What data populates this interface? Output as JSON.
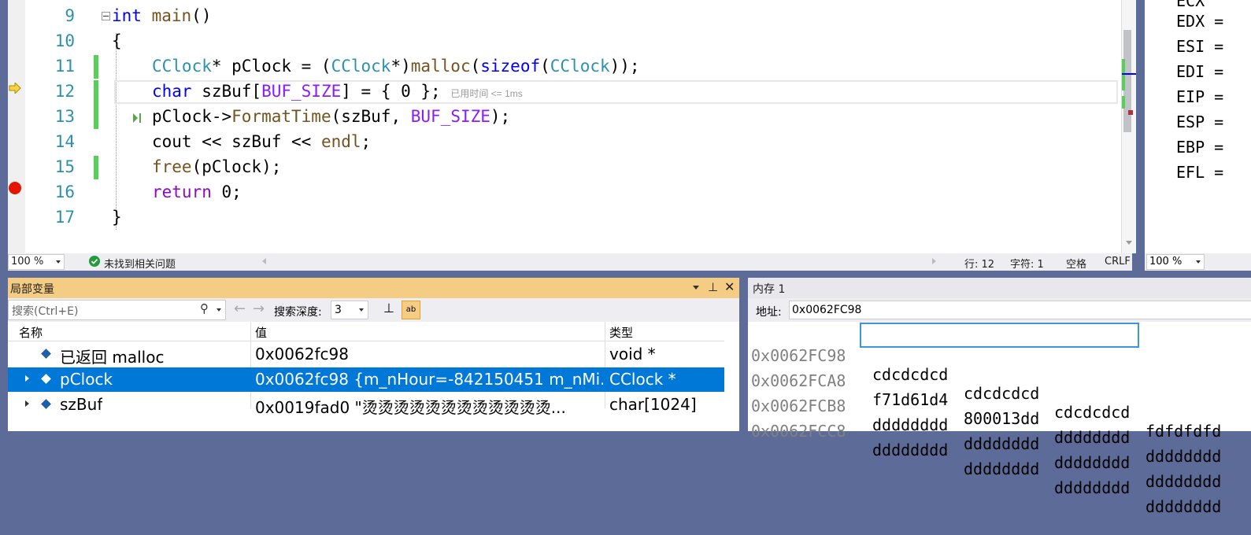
{
  "editor": {
    "lines": [
      {
        "num": "9"
      },
      {
        "num": "10"
      },
      {
        "num": "11"
      },
      {
        "num": "12"
      },
      {
        "num": "13"
      },
      {
        "num": "14"
      },
      {
        "num": "15"
      },
      {
        "num": "16"
      },
      {
        "num": "17"
      }
    ],
    "code": {
      "l9_kw": "int",
      "l9_fn": "main",
      "l9_rest": "()",
      "l10": "{",
      "l11_ty": "CClock",
      "l11_a": "* pClock = (",
      "l11_ty2": "CClock",
      "l11_b": "*)",
      "l11_fn": "malloc",
      "l11_c": "(",
      "l11_kw": "sizeof",
      "l11_d": "(",
      "l11_ty3": "CClock",
      "l11_e": "));",
      "l12_kw": "char",
      "l12_a": " szBuf[",
      "l12_mac": "BUF_SIZE",
      "l12_b": "] = { 0 };",
      "l12_hint": "已用时间 <= 1ms",
      "l13_a": "pClock->",
      "l13_fn": "FormatTime",
      "l13_b": "(szBuf, ",
      "l13_mac": "BUF_SIZE",
      "l13_c": ");",
      "l14_a": "cout << szBuf << ",
      "l14_fn": "endl",
      "l14_b": ";",
      "l15_fn": "free",
      "l15_a": "(pClock);",
      "l16_kw": "return",
      "l16_a": " 0;",
      "l17": "}"
    },
    "zoom": "100 %",
    "issues": "未找到相关问题",
    "row_label": "行: 12",
    "col_label": "字符: 1",
    "whitespace": "空格",
    "eol": "CRLF"
  },
  "registers": {
    "items": [
      {
        "name": "EDX ="
      },
      {
        "name": "ESI ="
      },
      {
        "name": "EDI ="
      },
      {
        "name": "EIP ="
      },
      {
        "name": "ESP ="
      },
      {
        "name": "EBP ="
      },
      {
        "name": "EFL ="
      }
    ],
    "zoom": "100 %"
  },
  "locals": {
    "title": "局部变量",
    "search_placeholder": "搜索(Ctrl+E)",
    "depth_label": "搜索深度:",
    "depth_value": "3",
    "columns": {
      "name": "名称",
      "value": "值",
      "type": "类型"
    },
    "rows": [
      {
        "name": "已返回 malloc",
        "value": "0x0062fc98",
        "type": "void *"
      },
      {
        "name": "pClock",
        "value": "0x0062fc98 {m_nHour=-842150451 m_nMi...",
        "type": "CClock *"
      },
      {
        "name": "szBuf",
        "value": "0x0019fad0 \"烫烫烫烫烫烫烫烫烫烫烫烫...",
        "type": "char[1024]"
      }
    ]
  },
  "memory": {
    "title": "内存 1",
    "addr_label": "地址:",
    "addr_value": "0x0062FC98",
    "rows": [
      {
        "addr": "0x0062FC98",
        "v1": "cdcdcdcd",
        "v2": "cdcdcdcd",
        "v3": "cdcdcdcd",
        "v4": "fdfdfdfd"
      },
      {
        "addr": "0x0062FCA8",
        "v1": "f71d61d4",
        "v2": "800013dd",
        "v3": "dddddddd",
        "v4": "dddddddd"
      },
      {
        "addr": "0x0062FCB8",
        "v1": "dddddddd",
        "v2": "dddddddd",
        "v3": "dddddddd",
        "v4": "dddddddd"
      },
      {
        "addr": "0x0062FCC8",
        "v1": "dddddddd",
        "v2": "dddddddd",
        "v3": "dddddddd",
        "v4": "dddddddd"
      }
    ]
  }
}
